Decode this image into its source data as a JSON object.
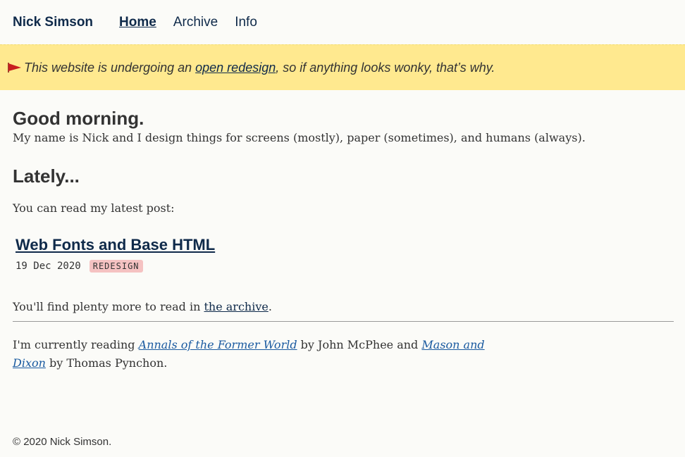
{
  "header": {
    "site_title": "Nick Simson",
    "nav": [
      {
        "label": "Home"
      },
      {
        "label": "Archive"
      },
      {
        "label": "Info"
      }
    ]
  },
  "banner": {
    "icon": "flag-icon",
    "text_before": "This website is undergoing an ",
    "link_text": "open redesign",
    "text_after": ", so if anything looks wonky, that’s why."
  },
  "main": {
    "greeting": "Good morning.",
    "intro": "My name is Nick and I design things for screens (mostly), paper (sometimes), and humans (always).",
    "lately_heading": "Lately...",
    "latest_label": "You can read my latest post:",
    "post": {
      "title": "Web Fonts and Base HTML",
      "date": "19 Dec 2020",
      "tag": "REDESIGN"
    },
    "more_before": "You'll find plenty more to read in ",
    "more_link": "the archive",
    "more_after": ".",
    "reading": {
      "before": "I'm currently reading ",
      "book1": "Annals of the Former World",
      "mid1": " by John McPhee and ",
      "book2": "Mason and Dixon",
      "after": " by Thomas Pynchon."
    }
  },
  "footer": {
    "copyright": "© 2020 Nick Simson."
  },
  "colors": {
    "background": "#fbfbf8",
    "banner": "#ffe98f",
    "link_dark": "#0f2a4a",
    "link_blue": "#1a5aa0",
    "tag_bg": "#f5c2c2",
    "flag": "#c81e1e"
  }
}
